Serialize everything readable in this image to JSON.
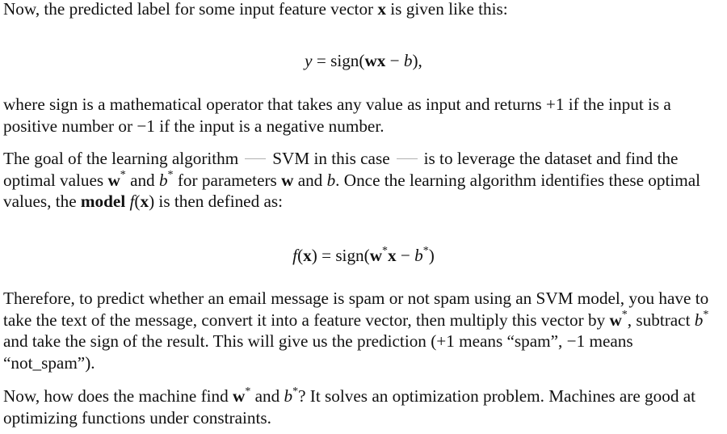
{
  "paragraphs": {
    "p1": {
      "t1": "Now, the predicted label for some input feature vector ",
      "x": "x",
      "t2": " is given like this:"
    },
    "eq1": {
      "y": "y",
      "eq": " = sign(",
      "wx": "wx",
      "minus": " − ",
      "b": "b",
      "close": "),"
    },
    "p2": "where sign is a mathematical operator that takes any value as input and returns +1 if the input is a positive number or −1 if the input is a negative number.",
    "p3": {
      "t1": "The goal of the learning algorithm",
      "t2": "SVM in this case",
      "t3": "is to leverage the dataset and find the optimal values ",
      "w": "w",
      "star": "*",
      "t4": " and ",
      "b": "b",
      "t5": " for parameters ",
      "w2": "w",
      "t6": " and ",
      "b2": "b",
      "t7": ". Once the learning algorithm identifies these optimal values, the ",
      "model": "model",
      "t8": " ",
      "f": "f",
      "t9": "(",
      "x": "x",
      "t10": ") is then defined as:"
    },
    "eq2": {
      "f": "f",
      "open": "(",
      "x": "x",
      "eq": ") = sign(",
      "w": "w",
      "star": "*",
      "x2": "x",
      "minus": " − ",
      "b": "b",
      "close": ")"
    },
    "p4": {
      "t1": "Therefore, to predict whether an email message is spam or not spam using an SVM model, you have to take the text of the message, convert it into a feature vector, then multiply this vector by ",
      "w": "w",
      "star": "*",
      "t2": ", subtract ",
      "b": "b",
      "t3": " and take the sign of the result. This will give us the prediction (+1 means “spam”, −1 means “not_spam”)."
    },
    "p5": {
      "t1": "Now, how does the machine find ",
      "w": "w",
      "star": "*",
      "t2": " and ",
      "b": "b",
      "t3": "? It solves an optimization problem. Machines are good at optimizing functions under constraints."
    }
  }
}
